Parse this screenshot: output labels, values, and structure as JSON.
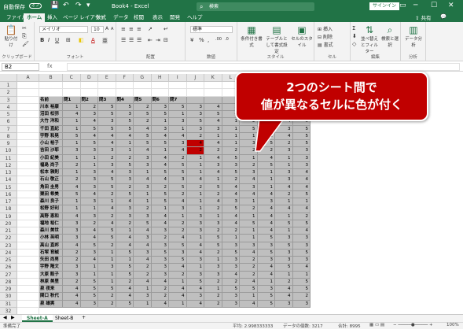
{
  "titlebar": {
    "autosave": "自動保存",
    "toggle": "オフ",
    "title": "Book4 - Excel",
    "search_placeholder": "検索",
    "signin": "サインイン",
    "save_icon": "💾",
    "undo_icon": "↶",
    "redo_icon": "↷",
    "more_icon": "▾",
    "ribbon_display_icon": "▭",
    "minimize_icon": "─",
    "maximize_icon": "☐",
    "close_icon": "✕"
  },
  "tabs": [
    "ファイル",
    "ホーム",
    "挿入",
    "ページ レイアウト",
    "数式",
    "データ",
    "校閲",
    "表示",
    "開発",
    "ヘルプ"
  ],
  "active_tab": 1,
  "share": "共有",
  "comment_icon": "💬",
  "ribbon": {
    "clipboard": {
      "paste": "貼り付け",
      "label": "クリップボード"
    },
    "font": {
      "name": "メイリオ",
      "size": "10",
      "bold": "B",
      "italic": "I",
      "underline": "U",
      "grow": "A",
      "shrink": "A",
      "color": "A",
      "label": "フォント"
    },
    "align": {
      "label": "配置"
    },
    "number": {
      "format": "標準",
      "label": "数値"
    },
    "styles": {
      "cond": "条件付き書式",
      "table": "テーブルとして書式設定",
      "cell": "セルのスタイル",
      "label": "スタイル"
    },
    "cells": {
      "insert": "挿入",
      "delete": "削除",
      "format": "書式",
      "label": "セル"
    },
    "edit": {
      "sort": "並べ替えとフィルター",
      "find": "検索と選択",
      "label": "編集"
    },
    "analysis": {
      "data": "データ分析",
      "label": "分析"
    }
  },
  "formulabar": {
    "namebox": "B2",
    "fx": "fx"
  },
  "columns": [
    "A",
    "B",
    "C",
    "D",
    "E",
    "F",
    "G",
    "H",
    "I",
    "J",
    "K",
    "L",
    "M",
    "N",
    "O",
    "P",
    "Q"
  ],
  "rows": [
    "1",
    "2",
    "3",
    "4",
    "5",
    "6",
    "7",
    "8",
    "9",
    "10",
    "11",
    "12",
    "13",
    "14",
    "15",
    "16",
    "17",
    "18",
    "19",
    "20",
    "21",
    "22",
    "23",
    "24",
    "25",
    "26",
    "27",
    "28",
    "29",
    "30",
    "31",
    "32",
    "33"
  ],
  "header_row": [
    "名前",
    "問1",
    "問2",
    "問3",
    "問4",
    "問5",
    "問6",
    "問7",
    "",
    "",
    "",
    "",
    "",
    "",
    ""
  ],
  "names": [
    "川本 裕康",
    "沼田 松弥",
    "大竹 洋和",
    "千田 直紀",
    "宇野 和晃",
    "小山 裕子",
    "吉田 沙耶",
    "小田 紀美",
    "福島 尚子",
    "松本 雅則",
    "石山 敬正",
    "角田 圭男",
    "栗田 希美",
    "森川 良子",
    "松野 好利",
    "高野 恵和",
    "福地 裕仁",
    "森川 美世",
    "小林 英明",
    "高山 直邦",
    "石塚 育誠",
    "矢田 尚男",
    "宇野 隆文",
    "大原 販子",
    "林原 美里",
    "泉 夜来",
    "関口 秋代",
    "泉 雄実"
  ],
  "scores": [
    [
      1,
      2,
      5,
      5,
      2,
      3,
      5,
      3,
      4,
      3,
      3,
      5,
      5,
      4
    ],
    [
      4,
      3,
      5,
      3,
      5,
      5,
      1,
      3,
      5,
      4,
      2,
      2,
      3,
      4
    ],
    [
      1,
      4,
      3,
      5,
      2,
      1,
      3,
      5,
      4,
      1,
      2,
      3,
      4,
      5
    ],
    [
      1,
      5,
      5,
      5,
      4,
      3,
      1,
      3,
      3,
      1,
      5,
      1,
      3,
      5
    ],
    [
      5,
      4,
      4,
      4,
      5,
      4,
      4,
      2,
      1,
      1,
      1,
      2,
      4,
      5
    ],
    [
      1,
      5,
      4,
      1,
      5,
      5,
      3,
      4,
      4,
      1,
      3,
      5,
      2,
      5
    ],
    [
      3,
      3,
      3,
      1,
      4,
      1,
      4,
      2,
      2,
      2,
      2,
      2,
      3,
      3
    ],
    [
      1,
      1,
      2,
      2,
      3,
      4,
      2,
      1,
      4,
      5,
      1,
      4,
      1,
      3
    ],
    [
      2,
      1,
      3,
      5,
      3,
      4,
      5,
      1,
      3,
      3,
      2,
      5,
      1,
      3
    ],
    [
      1,
      3,
      4,
      3,
      1,
      5,
      5,
      1,
      4,
      5,
      3,
      1,
      3,
      4
    ],
    [
      2,
      3,
      5,
      3,
      4,
      4,
      3,
      4,
      1,
      2,
      4,
      1,
      3,
      4
    ],
    [
      4,
      3,
      5,
      2,
      3,
      2,
      5,
      2,
      5,
      4,
      3,
      1,
      4,
      4
    ],
    [
      5,
      4,
      2,
      5,
      1,
      5,
      2,
      1,
      2,
      4,
      4,
      4,
      2,
      5
    ],
    [
      1,
      3,
      1,
      4,
      1,
      5,
      4,
      1,
      4,
      3,
      1,
      3,
      1,
      1
    ],
    [
      1,
      1,
      4,
      3,
      2,
      1,
      3,
      1,
      2,
      5,
      2,
      4,
      4,
      4
    ],
    [
      4,
      3,
      2,
      3,
      3,
      4,
      1,
      3,
      1,
      4,
      1,
      4,
      1,
      2
    ],
    [
      3,
      2,
      4,
      2,
      5,
      4,
      2,
      3,
      3,
      4,
      5,
      4,
      5,
      5
    ],
    [
      3,
      4,
      5,
      1,
      4,
      3,
      2,
      3,
      2,
      2,
      1,
      4,
      1,
      4
    ],
    [
      3,
      4,
      5,
      4,
      3,
      2,
      4,
      1,
      5,
      1,
      1,
      5,
      3,
      3
    ],
    [
      4,
      5,
      2,
      4,
      4,
      3,
      5,
      4,
      5,
      3,
      3,
      3,
      5,
      3
    ],
    [
      2,
      3,
      1,
      5,
      3,
      5,
      3,
      4,
      2,
      5,
      4,
      5,
      3,
      5
    ],
    [
      2,
      4,
      1,
      1,
      4,
      3,
      5,
      3,
      1,
      3,
      2,
      3,
      3,
      3
    ],
    [
      3,
      1,
      3,
      5,
      2,
      3,
      4,
      1,
      3,
      3,
      2,
      4,
      5,
      4
    ],
    [
      3,
      1,
      1,
      5,
      2,
      3,
      2,
      3,
      3,
      4,
      2,
      4,
      1,
      1
    ],
    [
      2,
      5,
      1,
      2,
      4,
      4,
      1,
      5,
      2,
      2,
      4,
      1,
      2,
      5
    ],
    [
      4,
      5,
      5,
      4,
      1,
      2,
      4,
      4,
      1,
      5,
      5,
      3,
      4,
      5
    ],
    [
      4,
      5,
      2,
      4,
      3,
      2,
      4,
      3,
      2,
      3,
      1,
      5,
      4,
      2
    ],
    [
      4,
      3,
      2,
      5,
      1,
      4,
      1,
      4,
      2,
      3,
      4,
      5,
      3,
      3
    ]
  ],
  "changed_cells": [
    [
      6,
      7
    ],
    [
      5,
      7
    ]
  ],
  "callout": {
    "line1": "2つのシート間で",
    "line2": "値が異なるセルに色が付く"
  },
  "sheets": [
    "Sheet-A",
    "Sheet-B"
  ],
  "add_sheet": "+",
  "status": {
    "left": "準備完了",
    "average": "平均: 2.998333333",
    "count": "データの個数: 3217",
    "sum": "合計: 8995",
    "zoom": "100%"
  },
  "colors": {
    "accent": "#217346",
    "callout": "#c00000",
    "highlight": "#c00000",
    "cell_fill": "#bfbfbf"
  }
}
